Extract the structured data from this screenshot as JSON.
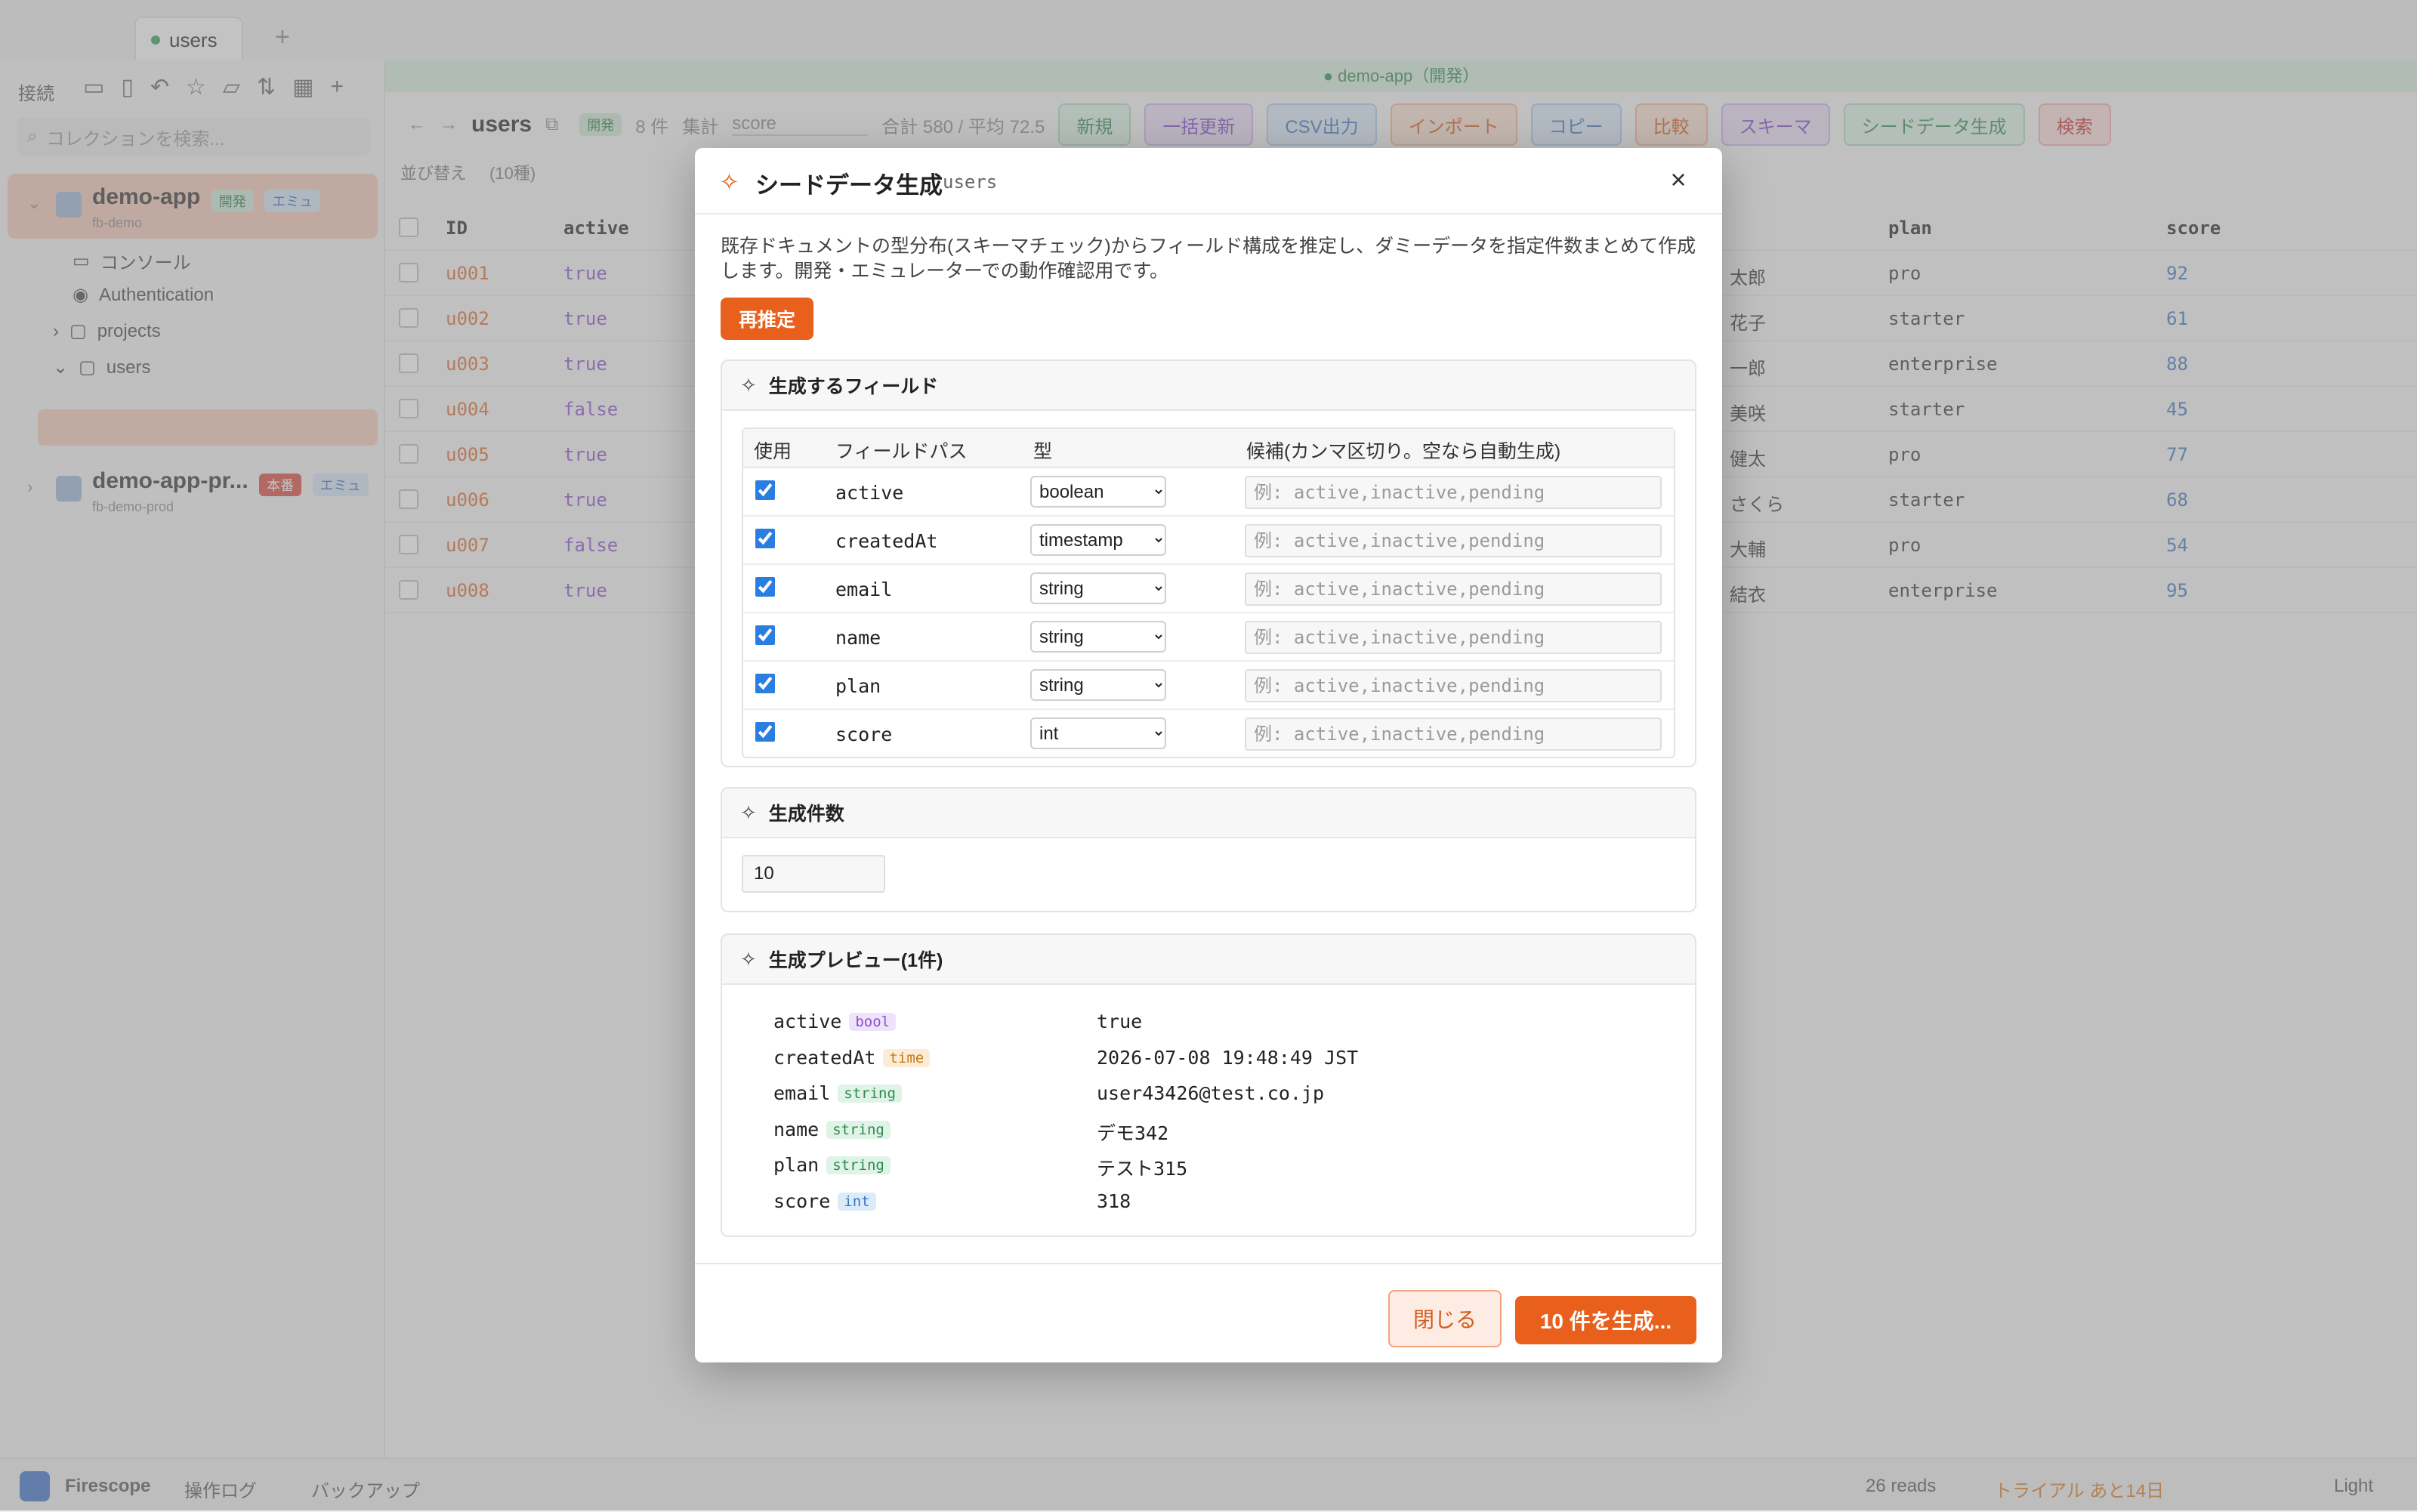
{
  "app": {
    "tab_label": "users",
    "env_banner": "● demo-app（開発）",
    "sidebar": {
      "label": "接続",
      "search_placeholder": "コレクションを検索...",
      "projects": [
        {
          "name": "demo-app",
          "sub": "fb-demo",
          "badges": [
            "開発",
            "エミュ"
          ]
        },
        {
          "name": "demo-app-pr...",
          "sub": "fb-demo-prod",
          "badges": [
            "本番",
            "エミュ"
          ]
        }
      ],
      "tree": [
        "コンソール",
        "Authentication",
        "projects",
        "users"
      ]
    },
    "toolbar": {
      "title": "users",
      "count": "8 件",
      "agg": "集計",
      "agg_field": "score",
      "stats": "合計 580 / 平均 72.5",
      "buttons": [
        "新規",
        "一括更新",
        "CSV出力",
        "インポート",
        "コピー",
        "比較",
        "スキーマ",
        "シードデータ生成",
        "検索"
      ]
    },
    "sortbar": {
      "sort": "並び替え",
      "count": "(10種)"
    },
    "table": {
      "headers": [
        "ID",
        "active",
        "name",
        "plan",
        "score"
      ],
      "rows": [
        [
          "u001",
          "true",
          "太郎",
          "pro",
          "92"
        ],
        [
          "u002",
          "true",
          "花子",
          "starter",
          "61"
        ],
        [
          "u003",
          "true",
          "一郎",
          "enterprise",
          "88"
        ],
        [
          "u004",
          "false",
          "美咲",
          "starter",
          "45"
        ],
        [
          "u005",
          "true",
          "健太",
          "pro",
          "77"
        ],
        [
          "u006",
          "true",
          "さくら",
          "starter",
          "68"
        ],
        [
          "u007",
          "false",
          "大輔",
          "pro",
          "54"
        ],
        [
          "u008",
          "true",
          "結衣",
          "enterprise",
          "95"
        ]
      ]
    },
    "status": {
      "brand": "Firescope",
      "log": "操作ログ",
      "backup": "バックアップ",
      "reads": "26 reads",
      "trial": "トライアル あと14日",
      "theme": "Light"
    }
  },
  "dialog": {
    "title": "シードデータ生成",
    "collection": "users",
    "close_icon": "close-icon",
    "description": "既存ドキュメントの型分布(スキーマチェック)からフィールド構成を推定し、ダミーデータを指定件数まとめて作成します。開発・エミュレーターでの動作確認用です。",
    "reinfer_label": "再推定",
    "fields_section": {
      "title": "生成するフィールド",
      "headers": {
        "use": "使用",
        "path": "フィールドパス",
        "type": "型",
        "candidates": "候補(カンマ区切り。空なら自動生成)"
      },
      "candidate_placeholder": "例: active,inactive,pending",
      "rows": [
        {
          "path": "active",
          "type": "boolean"
        },
        {
          "path": "createdAt",
          "type": "timestamp"
        },
        {
          "path": "email",
          "type": "string"
        },
        {
          "path": "name",
          "type": "string"
        },
        {
          "path": "plan",
          "type": "string"
        },
        {
          "path": "score",
          "type": "int"
        }
      ],
      "type_options": [
        "boolean",
        "timestamp",
        "string",
        "int"
      ]
    },
    "count_section": {
      "title": "生成件数",
      "value": "10"
    },
    "preview_section": {
      "title": "生成プレビュー(1件)",
      "rows": [
        {
          "key": "active",
          "type": "bool",
          "value": "true",
          "bg": "#efe3fb",
          "fg": "#8a4fd0"
        },
        {
          "key": "createdAt",
          "type": "time",
          "value": "2026-07-08 19:48:49 JST",
          "bg": "#fcecd6",
          "fg": "#c97a18"
        },
        {
          "key": "email",
          "type": "string",
          "value": "user43426@test.co.jp",
          "bg": "#dff3e6",
          "fg": "#2e8a50"
        },
        {
          "key": "name",
          "type": "string",
          "value": "デモ342",
          "bg": "#dff3e6",
          "fg": "#2e8a50"
        },
        {
          "key": "plan",
          "type": "string",
          "value": "テスト315",
          "bg": "#dff3e6",
          "fg": "#2e8a50"
        },
        {
          "key": "score",
          "type": "int",
          "value": "318",
          "bg": "#dcebf8",
          "fg": "#3a74c0"
        }
      ]
    },
    "footer": {
      "close_label": "閉じる",
      "generate_label": "10 件を生成..."
    }
  },
  "colors": {
    "accent": "#e8601c",
    "overlay": "rgba(140,140,140,0.5)"
  }
}
